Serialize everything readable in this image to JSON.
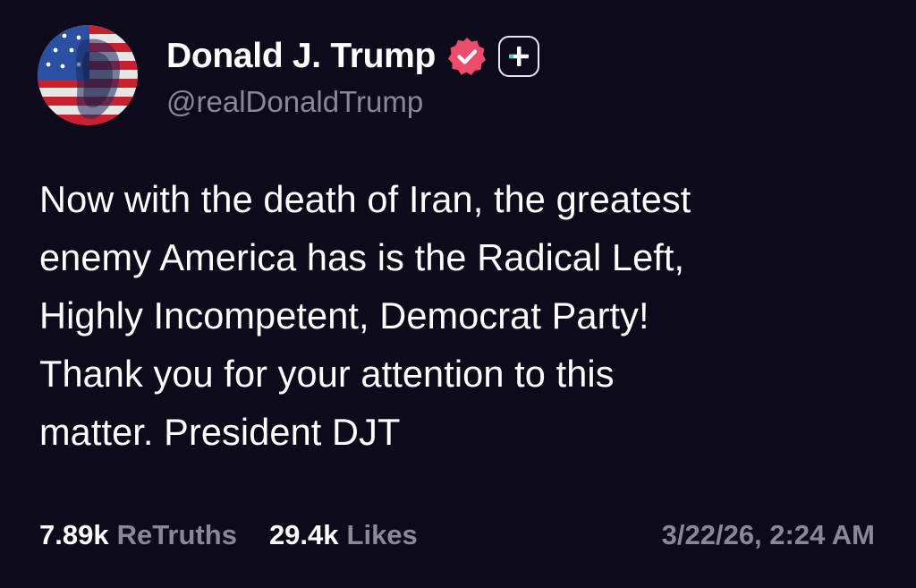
{
  "post": {
    "author": {
      "display_name": "Donald J. Trump",
      "handle": "@realDonaldTrump",
      "verified_icon": "verified-badge-icon",
      "follow_icon": "plus-icon"
    },
    "body_lines": [
      "Now with the death of Iran, the greatest",
      "enemy America has is the Radical Left,",
      "Highly Incompetent, Democrat Party!",
      "Thank you for your attention to this",
      "matter. President DJT"
    ],
    "stats": {
      "retruths_count": "7.89k",
      "retruths_label": "ReTruths",
      "likes_count": "29.4k",
      "likes_label": "Likes"
    },
    "timestamp": "3/22/26, 2:24 AM"
  },
  "colors": {
    "background": "#0d0a1c",
    "primary_text": "#ffffff",
    "secondary_text": "#8b8799",
    "verified_badge": "#ee4d6a",
    "accent_teal": "#3dd6c8"
  }
}
